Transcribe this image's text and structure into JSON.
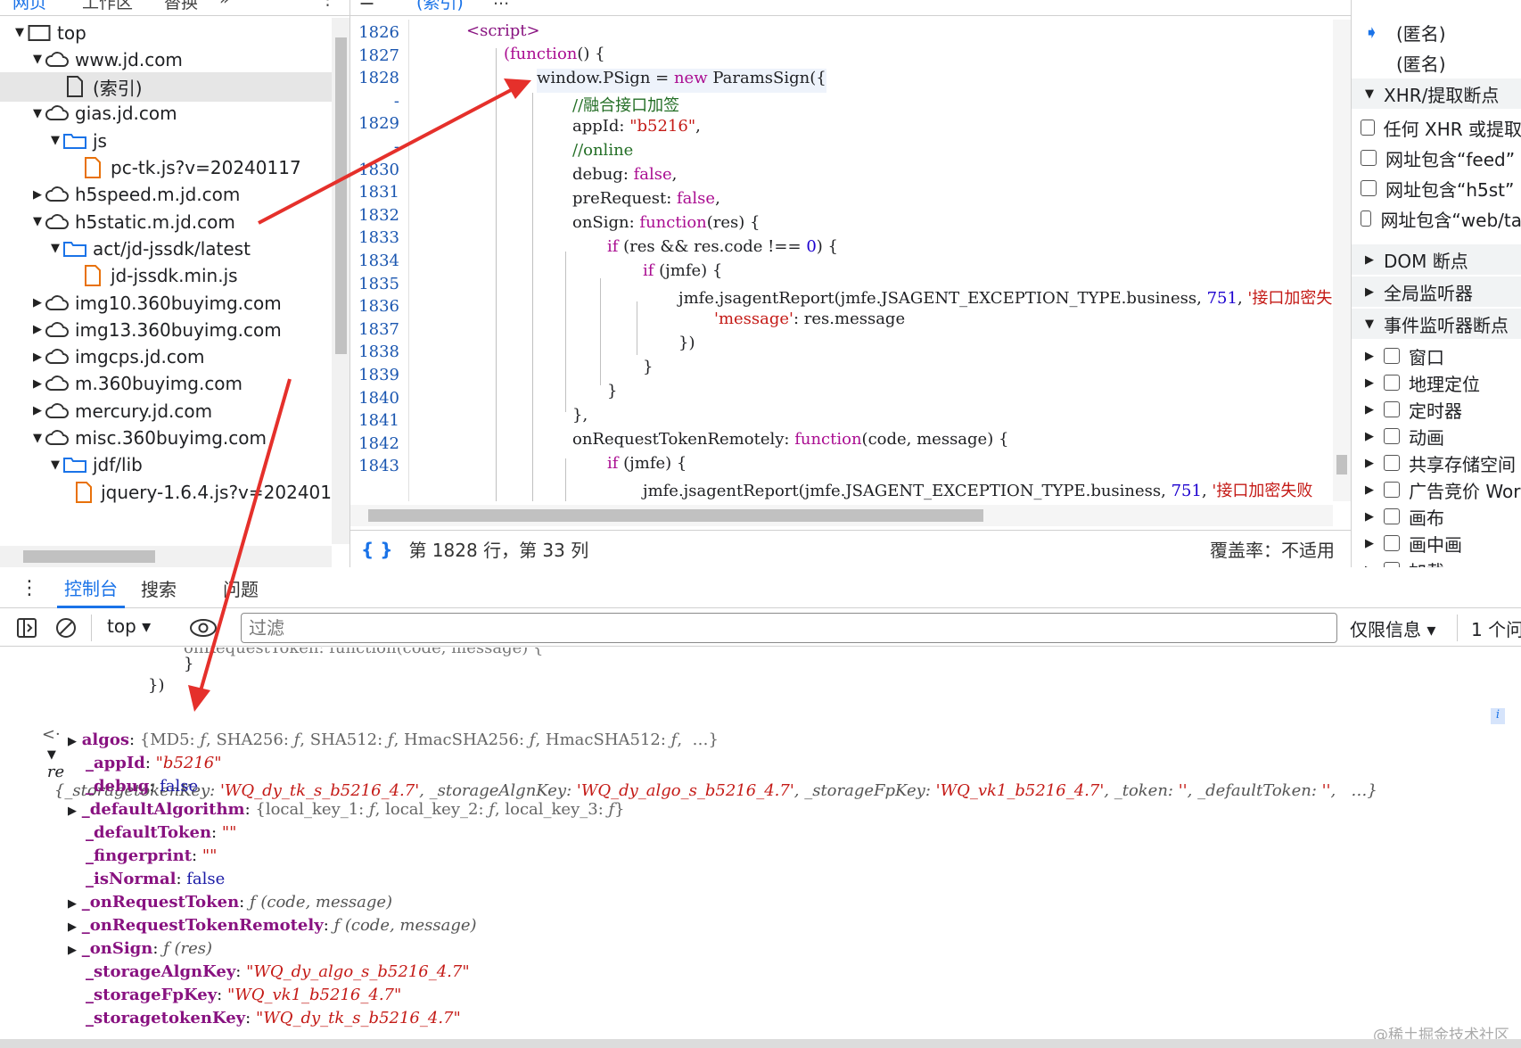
{
  "navigator": {
    "tabs": [
      "网页",
      "工作区",
      "替换"
    ],
    "tree": [
      {
        "label": "top",
        "depth": 0,
        "expanded": true,
        "icon": "frame"
      },
      {
        "label": "www.jd.com",
        "depth": 1,
        "expanded": true,
        "icon": "cloud"
      },
      {
        "label": "(索引)",
        "depth": 2,
        "icon": "file",
        "selected": true
      },
      {
        "label": "gias.jd.com",
        "depth": 1,
        "expanded": true,
        "icon": "cloud"
      },
      {
        "label": "js",
        "depth": 2,
        "expanded": true,
        "icon": "folder"
      },
      {
        "label": "pc-tk.js?v=20240117",
        "depth": 3,
        "icon": "file-orange"
      },
      {
        "label": "h5speed.m.jd.com",
        "depth": 1,
        "expanded": false,
        "icon": "cloud"
      },
      {
        "label": "h5static.m.jd.com",
        "depth": 1,
        "expanded": true,
        "icon": "cloud"
      },
      {
        "label": "act/jd-jssdk/latest",
        "depth": 2,
        "expanded": true,
        "icon": "folder"
      },
      {
        "label": "jd-jssdk.min.js",
        "depth": 3,
        "icon": "file-orange"
      },
      {
        "label": "img10.360buyimg.com",
        "depth": 1,
        "expanded": false,
        "icon": "cloud"
      },
      {
        "label": "img13.360buyimg.com",
        "depth": 1,
        "expanded": false,
        "icon": "cloud"
      },
      {
        "label": "imgcps.jd.com",
        "depth": 1,
        "expanded": false,
        "icon": "cloud"
      },
      {
        "label": "m.360buyimg.com",
        "depth": 1,
        "expanded": false,
        "icon": "cloud"
      },
      {
        "label": "mercury.jd.com",
        "depth": 1,
        "expanded": false,
        "icon": "cloud"
      },
      {
        "label": "misc.360buyimg.com",
        "depth": 1,
        "expanded": true,
        "icon": "cloud"
      },
      {
        "label": "jdf/lib",
        "depth": 2,
        "expanded": true,
        "icon": "folder"
      },
      {
        "label": "jquery-1.6.4.js?v=202401",
        "depth": 3,
        "icon": "file-orange"
      }
    ]
  },
  "editor": {
    "tabs": [
      "(索引)",
      "..."
    ],
    "line_numbers": [
      "1826",
      "1827",
      "1828",
      "-",
      "1829",
      "-",
      "1830",
      "1831",
      "1832",
      "1833",
      "1834",
      "1835",
      "1836",
      "1837",
      "1838",
      "1839",
      "1840",
      "1841",
      "1842",
      "1843"
    ],
    "status_position": "第 1828 行，第 33 列",
    "status_coverage": "覆盖率：不适用",
    "format_icon": "{ }"
  },
  "debugger": {
    "callstack": [
      "(匿名)",
      "(匿名)"
    ],
    "xhr_section": "XHR/提取断点",
    "xhr_items": [
      "任何 XHR 或提取",
      "网址包含“feed”",
      "网址包含“h5st”",
      "网址包含“web/ta"
    ],
    "dom_section": "DOM 断点",
    "global_section": "全局监听器",
    "event_section": "事件监听器断点",
    "event_items": [
      "窗口",
      "地理定位",
      "定时器",
      "动画",
      "共享存储空间",
      "广告竞价 Wor",
      "画布",
      "画中画",
      "加载"
    ]
  },
  "drawer": {
    "tabs": [
      "控制台",
      "搜索",
      "问题"
    ],
    "context": "top",
    "filter_placeholder": "过滤",
    "level": "仅限信息 ▾",
    "issues": "1 个问"
  },
  "console": {
    "ghost_line": "onRequestToken: function(code, message) {",
    "close_brace": "}",
    "close_call": "})",
    "object_var": "re",
    "object_summary_1": "{_storagetokenKey: ",
    "object_summary_v1": "'WQ_dy_tk_s_b5216_4.7'",
    "object_summary_2": ", _storageAlgnKey: ",
    "object_summary_v2": "'WQ_dy_algo_s_b5216_4.7'",
    "object_summary_3": ", _storageFpKey: ",
    "object_summary_v3": "'WQ_vk1_b5216_4.7'",
    "object_summary_4": ", _token: ",
    "object_summary_v4": "''",
    "object_summary_5": ", _defaultToken: ",
    "object_summary_v5": "''",
    "object_summary_6": ",   …}",
    "watermark": "@稀土掘金技术社区"
  },
  "colors": {
    "accent": "#1a73e8",
    "annotation_arrow": "#e5302b"
  }
}
